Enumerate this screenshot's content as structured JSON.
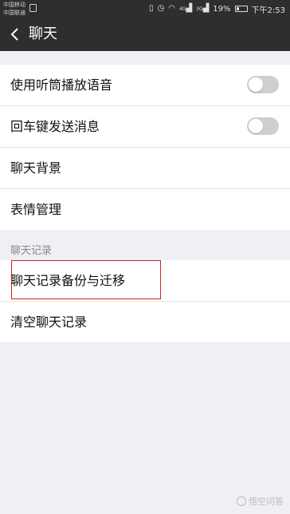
{
  "status_bar": {
    "carrier1": "中国移动",
    "carrier2": "中国联通",
    "signal1": "4G",
    "signal2": "3G",
    "battery": "19%",
    "time": "下午2:53"
  },
  "nav": {
    "title": "聊天"
  },
  "settings_group1": [
    {
      "label": "使用听筒播放语音",
      "toggle": false
    },
    {
      "label": "回车键发送消息",
      "toggle": false
    },
    {
      "label": "聊天背景"
    },
    {
      "label": "表情管理"
    }
  ],
  "section2_header": "聊天记录",
  "settings_group2": [
    {
      "label": "聊天记录备份与迁移"
    },
    {
      "label": "清空聊天记录"
    }
  ],
  "watermark": "悟空问答",
  "colors": {
    "toolbar": "#2e2e2e",
    "background": "#efeff4",
    "highlight": "#cc2222",
    "toggle_off": "#cfcfcf"
  }
}
